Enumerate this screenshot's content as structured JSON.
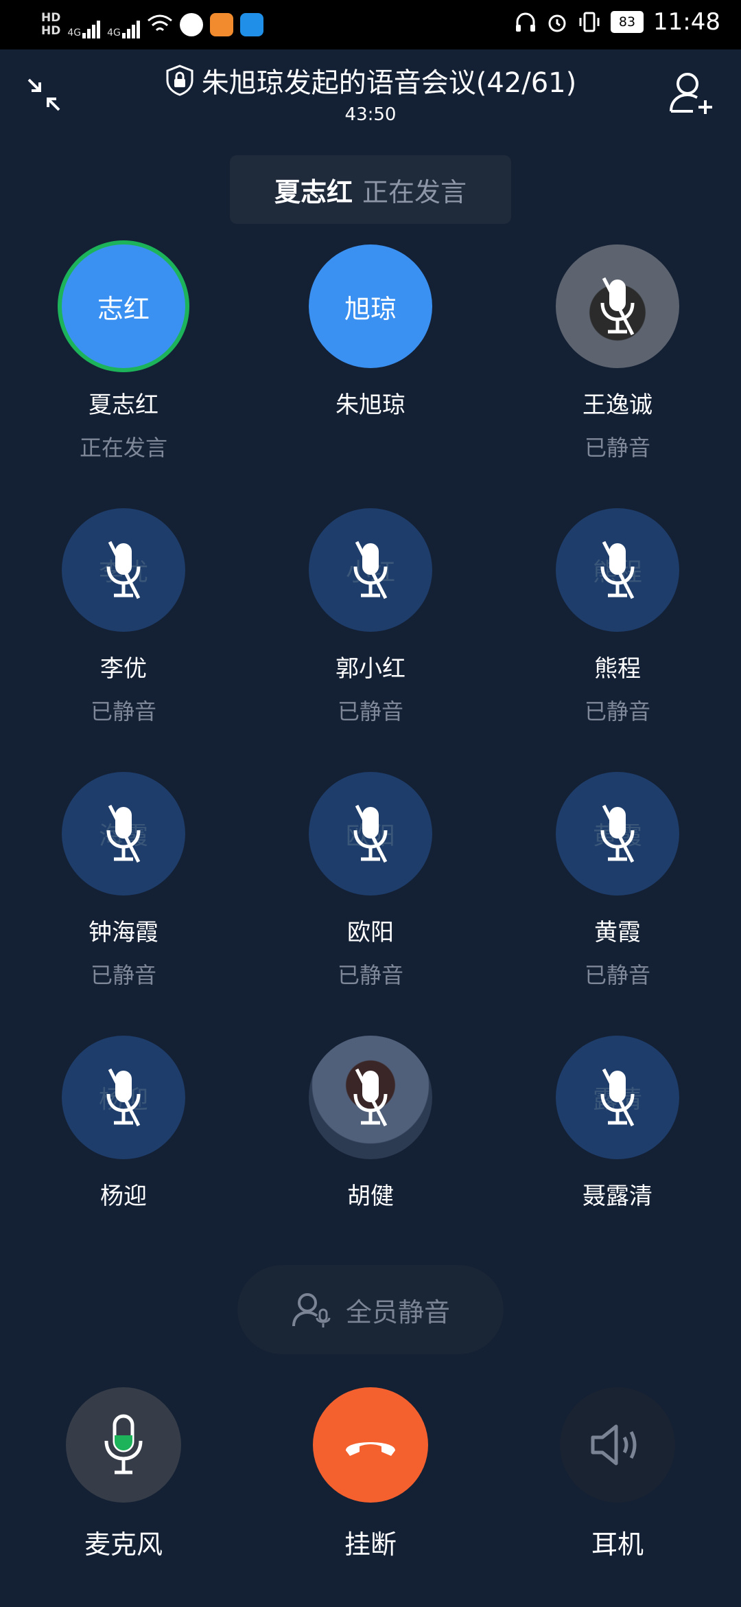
{
  "status_bar": {
    "hd1": "HD",
    "hd2": "HD",
    "net1": "4G",
    "net2": "4G",
    "battery": "83",
    "time": "11:48"
  },
  "header": {
    "title": "朱旭琼发起的语音会议(42/61)",
    "timer": "43:50"
  },
  "speaking": {
    "name": "夏志红",
    "status": "正在发言"
  },
  "participants": [
    {
      "name": "夏志红",
      "status": "正在发言",
      "avatar_text": "志红"
    },
    {
      "name": "朱旭琼",
      "status": "",
      "avatar_text": "旭琼"
    },
    {
      "name": "王逸诚",
      "status": "已静音",
      "avatar_text": ""
    },
    {
      "name": "李优",
      "status": "已静音",
      "avatar_text": "李优"
    },
    {
      "name": "郭小红",
      "status": "已静音",
      "avatar_text": "小红"
    },
    {
      "name": "熊程",
      "status": "已静音",
      "avatar_text": "熊程"
    },
    {
      "name": "钟海霞",
      "status": "已静音",
      "avatar_text": "海霞"
    },
    {
      "name": "欧阳",
      "status": "已静音",
      "avatar_text": "欧阳"
    },
    {
      "name": "黄霞",
      "status": "已静音",
      "avatar_text": "黄霞"
    },
    {
      "name": "杨迎",
      "status": "",
      "avatar_text": "杨迎"
    },
    {
      "name": "胡健",
      "status": "",
      "avatar_text": ""
    },
    {
      "name": "聂露清",
      "status": "",
      "avatar_text": "露清"
    }
  ],
  "mute_all": "全员静音",
  "controls": {
    "mic": "麦克风",
    "hangup": "挂断",
    "earpiece": "耳机"
  },
  "colors": {
    "background": "#142034",
    "avatar_blue": "#3a91f2",
    "avatar_muted": "#1e3d6a",
    "speaking_ring": "#1db35a",
    "hangup": "#f4612e"
  }
}
